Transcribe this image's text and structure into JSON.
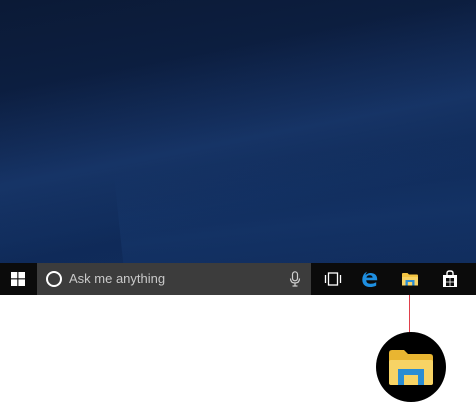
{
  "taskbar": {
    "search": {
      "placeholder": "Ask me anything"
    },
    "buttons": {
      "start": {
        "icon": "windows-logo-icon"
      },
      "cortana": {
        "icon": "cortana-circle-icon"
      },
      "microphone": {
        "icon": "microphone-icon"
      },
      "task_view": {
        "icon": "task-view-icon"
      },
      "edge": {
        "icon": "edge-e-icon"
      },
      "file_explorer": {
        "icon": "folder-icon"
      },
      "store": {
        "icon": "store-bag-icon"
      }
    }
  },
  "callout": {
    "icon": "file-explorer-folder-icon",
    "line_color": "#e0404b"
  },
  "colors": {
    "taskbar_bg": "#0b0b0b",
    "search_bg": "#3c3c3c",
    "desktop_bg": "#0d2147",
    "edge_blue": "#1e8fe1",
    "folder_yellow": "#f4c542",
    "folder_blue": "#2a8dd4"
  }
}
